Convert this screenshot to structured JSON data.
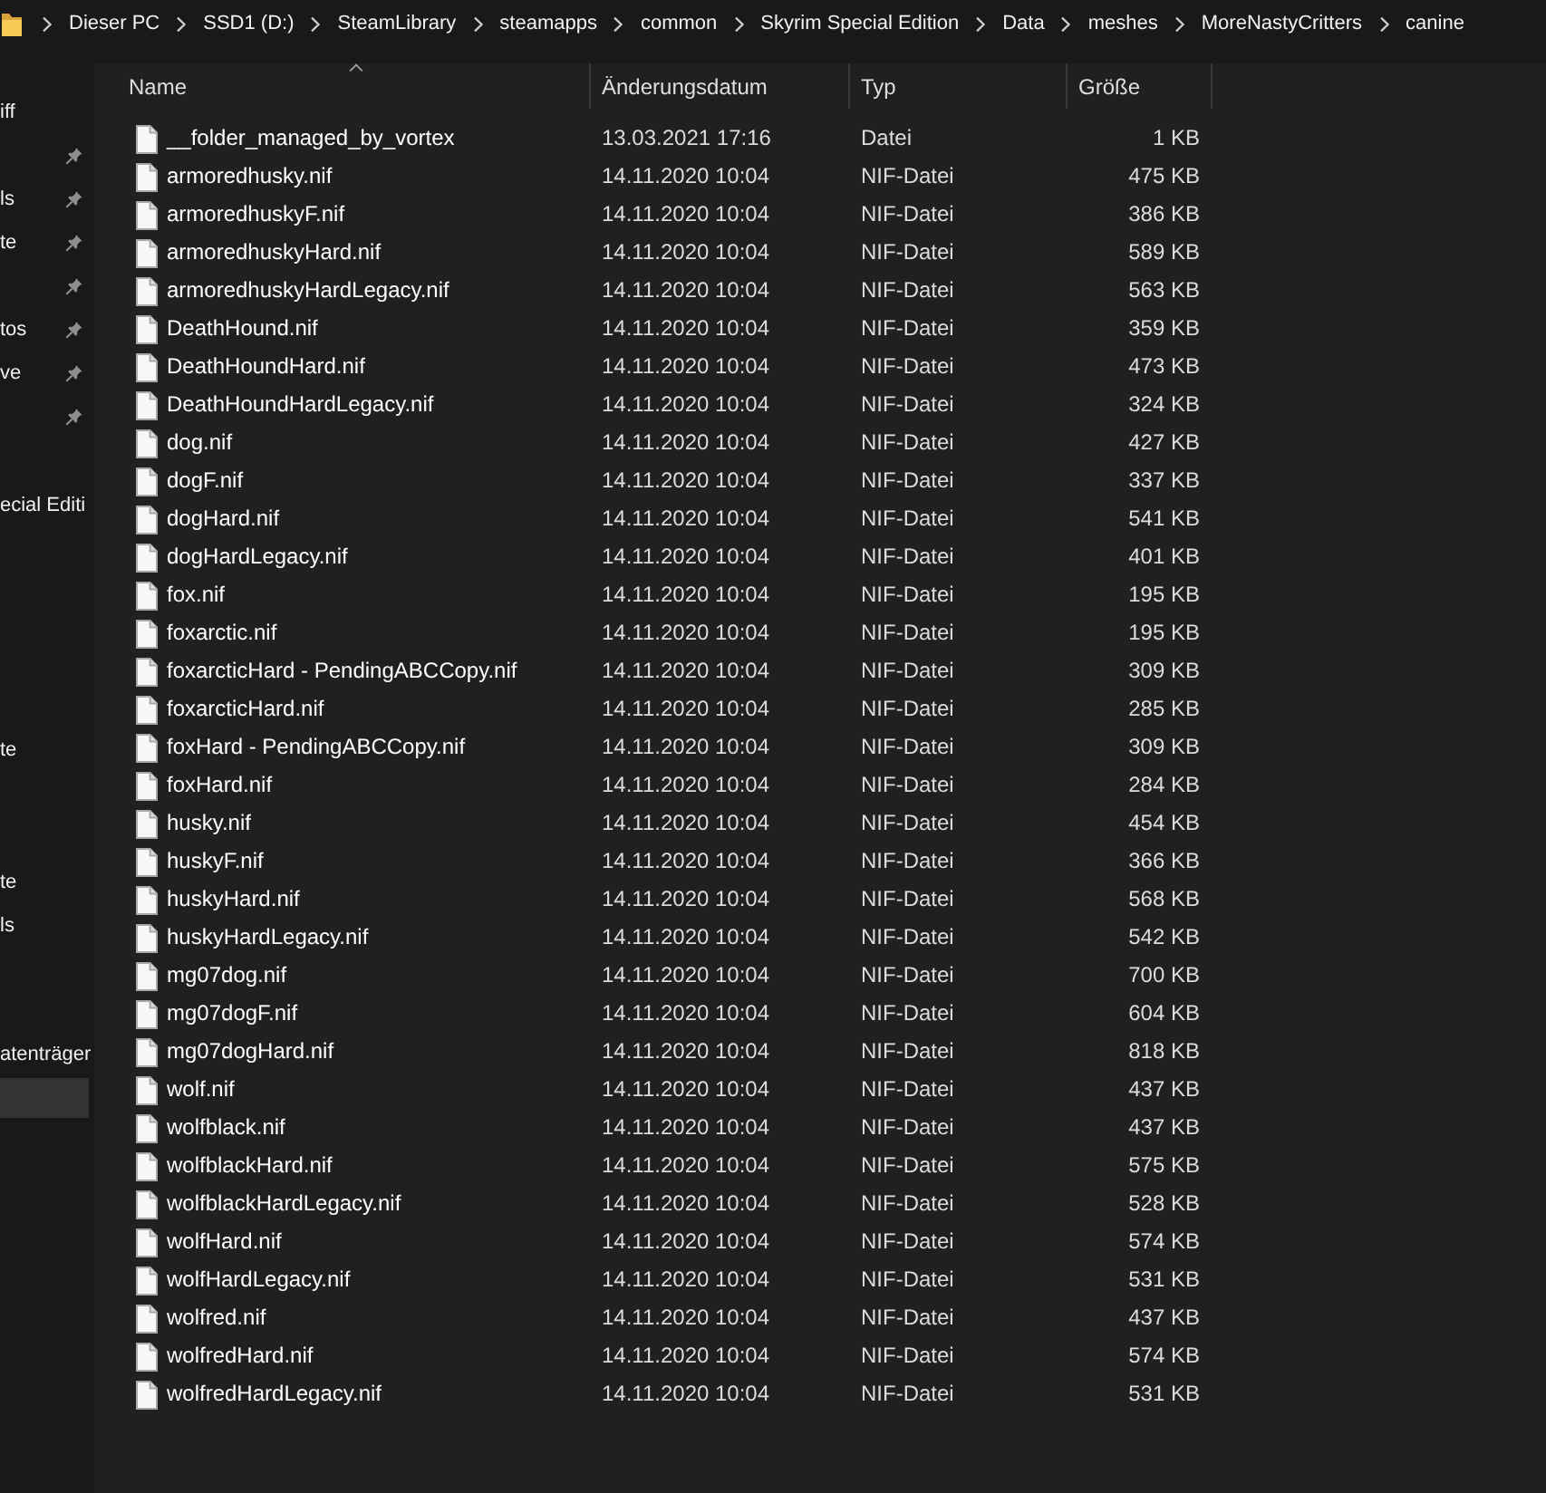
{
  "breadcrumb": [
    "Dieser PC",
    "SSD1 (D:)",
    "SteamLibrary",
    "steamapps",
    "common",
    "Skyrim Special Edition",
    "Data",
    "meshes",
    "MoreNastyCritters",
    "canine"
  ],
  "sidebar": {
    "sections": [
      {
        "items": [
          {
            "label": "iff",
            "pinned": false,
            "selected": false
          },
          {
            "pinned": true,
            "selected": false
          },
          {
            "label": "ls",
            "pinned": true,
            "selected": false
          },
          {
            "label": "te",
            "pinned": true,
            "selected": false
          },
          {
            "pinned": true,
            "selected": false
          },
          {
            "label": "tos",
            "pinned": true,
            "selected": false
          },
          {
            "label": "ve",
            "pinned": true,
            "selected": false
          },
          {
            "pinned": true,
            "selected": false
          }
        ]
      },
      {
        "items": [
          {
            "label": "ecial Editi",
            "pinned": false,
            "selected": false
          }
        ]
      },
      {
        "items": [
          {
            "label": "te",
            "pinned": false,
            "selected": false
          }
        ]
      },
      {
        "items": [
          {
            "label": "te",
            "pinned": false,
            "selected": false
          },
          {
            "label": "ls",
            "pinned": false,
            "selected": false
          }
        ]
      },
      {
        "items": [
          {
            "label": "atenträger",
            "pinned": false,
            "selected": false
          },
          {
            "pinned": false,
            "selected": true
          }
        ]
      }
    ]
  },
  "file_list": {
    "columns": [
      {
        "label": "Name",
        "sorted": true
      },
      {
        "label": "Änderungsdatum",
        "sorted": false
      },
      {
        "label": "Typ",
        "sorted": false
      },
      {
        "label": "Größe",
        "sorted": false
      }
    ],
    "rows": [
      {
        "name": "__folder_managed_by_vortex",
        "modified": "13.03.2021 17:16",
        "type": "Datei",
        "size": "1 KB"
      },
      {
        "name": "armoredhusky.nif",
        "modified": "14.11.2020 10:04",
        "type": "NIF-Datei",
        "size": "475 KB"
      },
      {
        "name": "armoredhuskyF.nif",
        "modified": "14.11.2020 10:04",
        "type": "NIF-Datei",
        "size": "386 KB"
      },
      {
        "name": "armoredhuskyHard.nif",
        "modified": "14.11.2020 10:04",
        "type": "NIF-Datei",
        "size": "589 KB"
      },
      {
        "name": "armoredhuskyHardLegacy.nif",
        "modified": "14.11.2020 10:04",
        "type": "NIF-Datei",
        "size": "563 KB"
      },
      {
        "name": "DeathHound.nif",
        "modified": "14.11.2020 10:04",
        "type": "NIF-Datei",
        "size": "359 KB"
      },
      {
        "name": "DeathHoundHard.nif",
        "modified": "14.11.2020 10:04",
        "type": "NIF-Datei",
        "size": "473 KB"
      },
      {
        "name": "DeathHoundHardLegacy.nif",
        "modified": "14.11.2020 10:04",
        "type": "NIF-Datei",
        "size": "324 KB"
      },
      {
        "name": "dog.nif",
        "modified": "14.11.2020 10:04",
        "type": "NIF-Datei",
        "size": "427 KB"
      },
      {
        "name": "dogF.nif",
        "modified": "14.11.2020 10:04",
        "type": "NIF-Datei",
        "size": "337 KB"
      },
      {
        "name": "dogHard.nif",
        "modified": "14.11.2020 10:04",
        "type": "NIF-Datei",
        "size": "541 KB"
      },
      {
        "name": "dogHardLegacy.nif",
        "modified": "14.11.2020 10:04",
        "type": "NIF-Datei",
        "size": "401 KB"
      },
      {
        "name": "fox.nif",
        "modified": "14.11.2020 10:04",
        "type": "NIF-Datei",
        "size": "195 KB"
      },
      {
        "name": "foxarctic.nif",
        "modified": "14.11.2020 10:04",
        "type": "NIF-Datei",
        "size": "195 KB"
      },
      {
        "name": "foxarcticHard - PendingABCCopy.nif",
        "modified": "14.11.2020 10:04",
        "type": "NIF-Datei",
        "size": "309 KB"
      },
      {
        "name": "foxarcticHard.nif",
        "modified": "14.11.2020 10:04",
        "type": "NIF-Datei",
        "size": "285 KB"
      },
      {
        "name": "foxHard - PendingABCCopy.nif",
        "modified": "14.11.2020 10:04",
        "type": "NIF-Datei",
        "size": "309 KB"
      },
      {
        "name": "foxHard.nif",
        "modified": "14.11.2020 10:04",
        "type": "NIF-Datei",
        "size": "284 KB"
      },
      {
        "name": "husky.nif",
        "modified": "14.11.2020 10:04",
        "type": "NIF-Datei",
        "size": "454 KB"
      },
      {
        "name": "huskyF.nif",
        "modified": "14.11.2020 10:04",
        "type": "NIF-Datei",
        "size": "366 KB"
      },
      {
        "name": "huskyHard.nif",
        "modified": "14.11.2020 10:04",
        "type": "NIF-Datei",
        "size": "568 KB"
      },
      {
        "name": "huskyHardLegacy.nif",
        "modified": "14.11.2020 10:04",
        "type": "NIF-Datei",
        "size": "542 KB"
      },
      {
        "name": "mg07dog.nif",
        "modified": "14.11.2020 10:04",
        "type": "NIF-Datei",
        "size": "700 KB"
      },
      {
        "name": "mg07dogF.nif",
        "modified": "14.11.2020 10:04",
        "type": "NIF-Datei",
        "size": "604 KB"
      },
      {
        "name": "mg07dogHard.nif",
        "modified": "14.11.2020 10:04",
        "type": "NIF-Datei",
        "size": "818 KB"
      },
      {
        "name": "wolf.nif",
        "modified": "14.11.2020 10:04",
        "type": "NIF-Datei",
        "size": "437 KB"
      },
      {
        "name": "wolfblack.nif",
        "modified": "14.11.2020 10:04",
        "type": "NIF-Datei",
        "size": "437 KB"
      },
      {
        "name": "wolfblackHard.nif",
        "modified": "14.11.2020 10:04",
        "type": "NIF-Datei",
        "size": "575 KB"
      },
      {
        "name": "wolfblackHardLegacy.nif",
        "modified": "14.11.2020 10:04",
        "type": "NIF-Datei",
        "size": "528 KB"
      },
      {
        "name": "wolfHard.nif",
        "modified": "14.11.2020 10:04",
        "type": "NIF-Datei",
        "size": "574 KB"
      },
      {
        "name": "wolfHardLegacy.nif",
        "modified": "14.11.2020 10:04",
        "type": "NIF-Datei",
        "size": "531 KB"
      },
      {
        "name": "wolfred.nif",
        "modified": "14.11.2020 10:04",
        "type": "NIF-Datei",
        "size": "437 KB"
      },
      {
        "name": "wolfredHard.nif",
        "modified": "14.11.2020 10:04",
        "type": "NIF-Datei",
        "size": "574 KB"
      },
      {
        "name": "wolfredHardLegacy.nif",
        "modified": "14.11.2020 10:04",
        "type": "NIF-Datei",
        "size": "531 KB"
      }
    ]
  }
}
